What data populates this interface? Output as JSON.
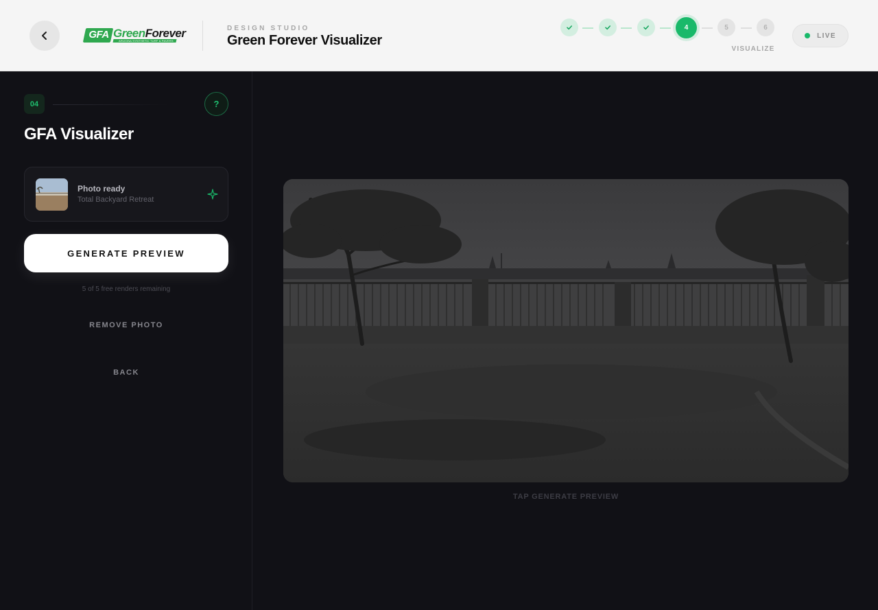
{
  "header": {
    "back_icon": "chevron-left-icon",
    "logo": {
      "badge": "GFA",
      "word_green": "Green",
      "word_dark": "Forever",
      "tagline": "ARIZONA SYNTHETIC TURF & PAVERS"
    },
    "eyebrow": "DESIGN STUDIO",
    "title": "Green Forever Visualizer",
    "stepper": {
      "steps": [
        {
          "label": "",
          "state": "done"
        },
        {
          "label": "",
          "state": "done"
        },
        {
          "label": "",
          "state": "done"
        },
        {
          "label": "4",
          "state": "current"
        },
        {
          "label": "5",
          "state": "future"
        },
        {
          "label": "6",
          "state": "future"
        }
      ],
      "current_label": "VISUALIZE"
    },
    "status": "LIVE",
    "accent": "#19b96a"
  },
  "sidebar": {
    "step_number": "04",
    "help_label": "?",
    "title": "GFA Visualizer",
    "photo_card": {
      "status": "Photo ready",
      "subtitle": "Total Backyard Retreat",
      "icon": "sparkle-icon"
    },
    "generate_label": "GENERATE PREVIEW",
    "renders_remaining": "5 of 5 free renders remaining",
    "remove_label": "REMOVE PHOTO",
    "back_label": "BACK"
  },
  "main": {
    "caption": "TAP GENERATE PREVIEW"
  }
}
